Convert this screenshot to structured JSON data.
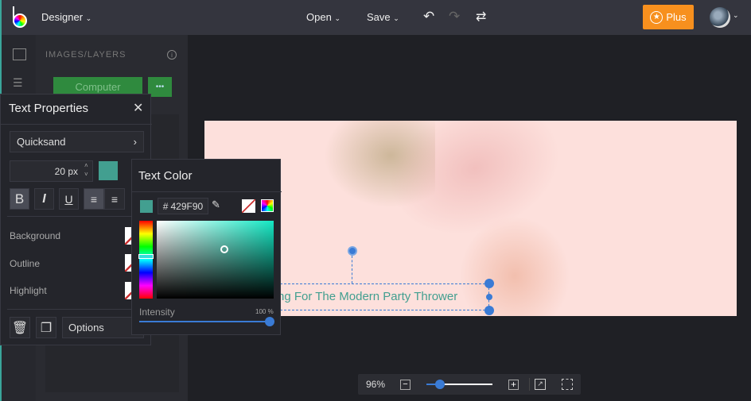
{
  "topbar": {
    "app_menu": "Designer",
    "open": "Open",
    "save": "Save",
    "plus": "Plus"
  },
  "sidebar": {
    "title": "IMAGES/LAYERS",
    "computer_button": "Computer",
    "more": "•••"
  },
  "text_properties": {
    "title": "Text Properties",
    "font": "Quicksand",
    "size": "20 px",
    "color": "#429F90",
    "rows": [
      "Background",
      "Outline",
      "Highlight"
    ],
    "options": "Options"
  },
  "text_color": {
    "title": "Text Color",
    "hex_prefix": "#",
    "hex": "429F90",
    "intensity_label": "Intensity",
    "intensity_value": "100 %",
    "intensity": 100
  },
  "canvas": {
    "text": "ng For The Modern Party Thrower",
    "text_color": "#429F90",
    "bg": "#FDE0DC"
  },
  "zoom": {
    "value": "96%",
    "level": 0.2
  },
  "colors": {
    "accent": "#3A7BD5",
    "plus": "#F7901E",
    "green": "#2F8A3E"
  }
}
